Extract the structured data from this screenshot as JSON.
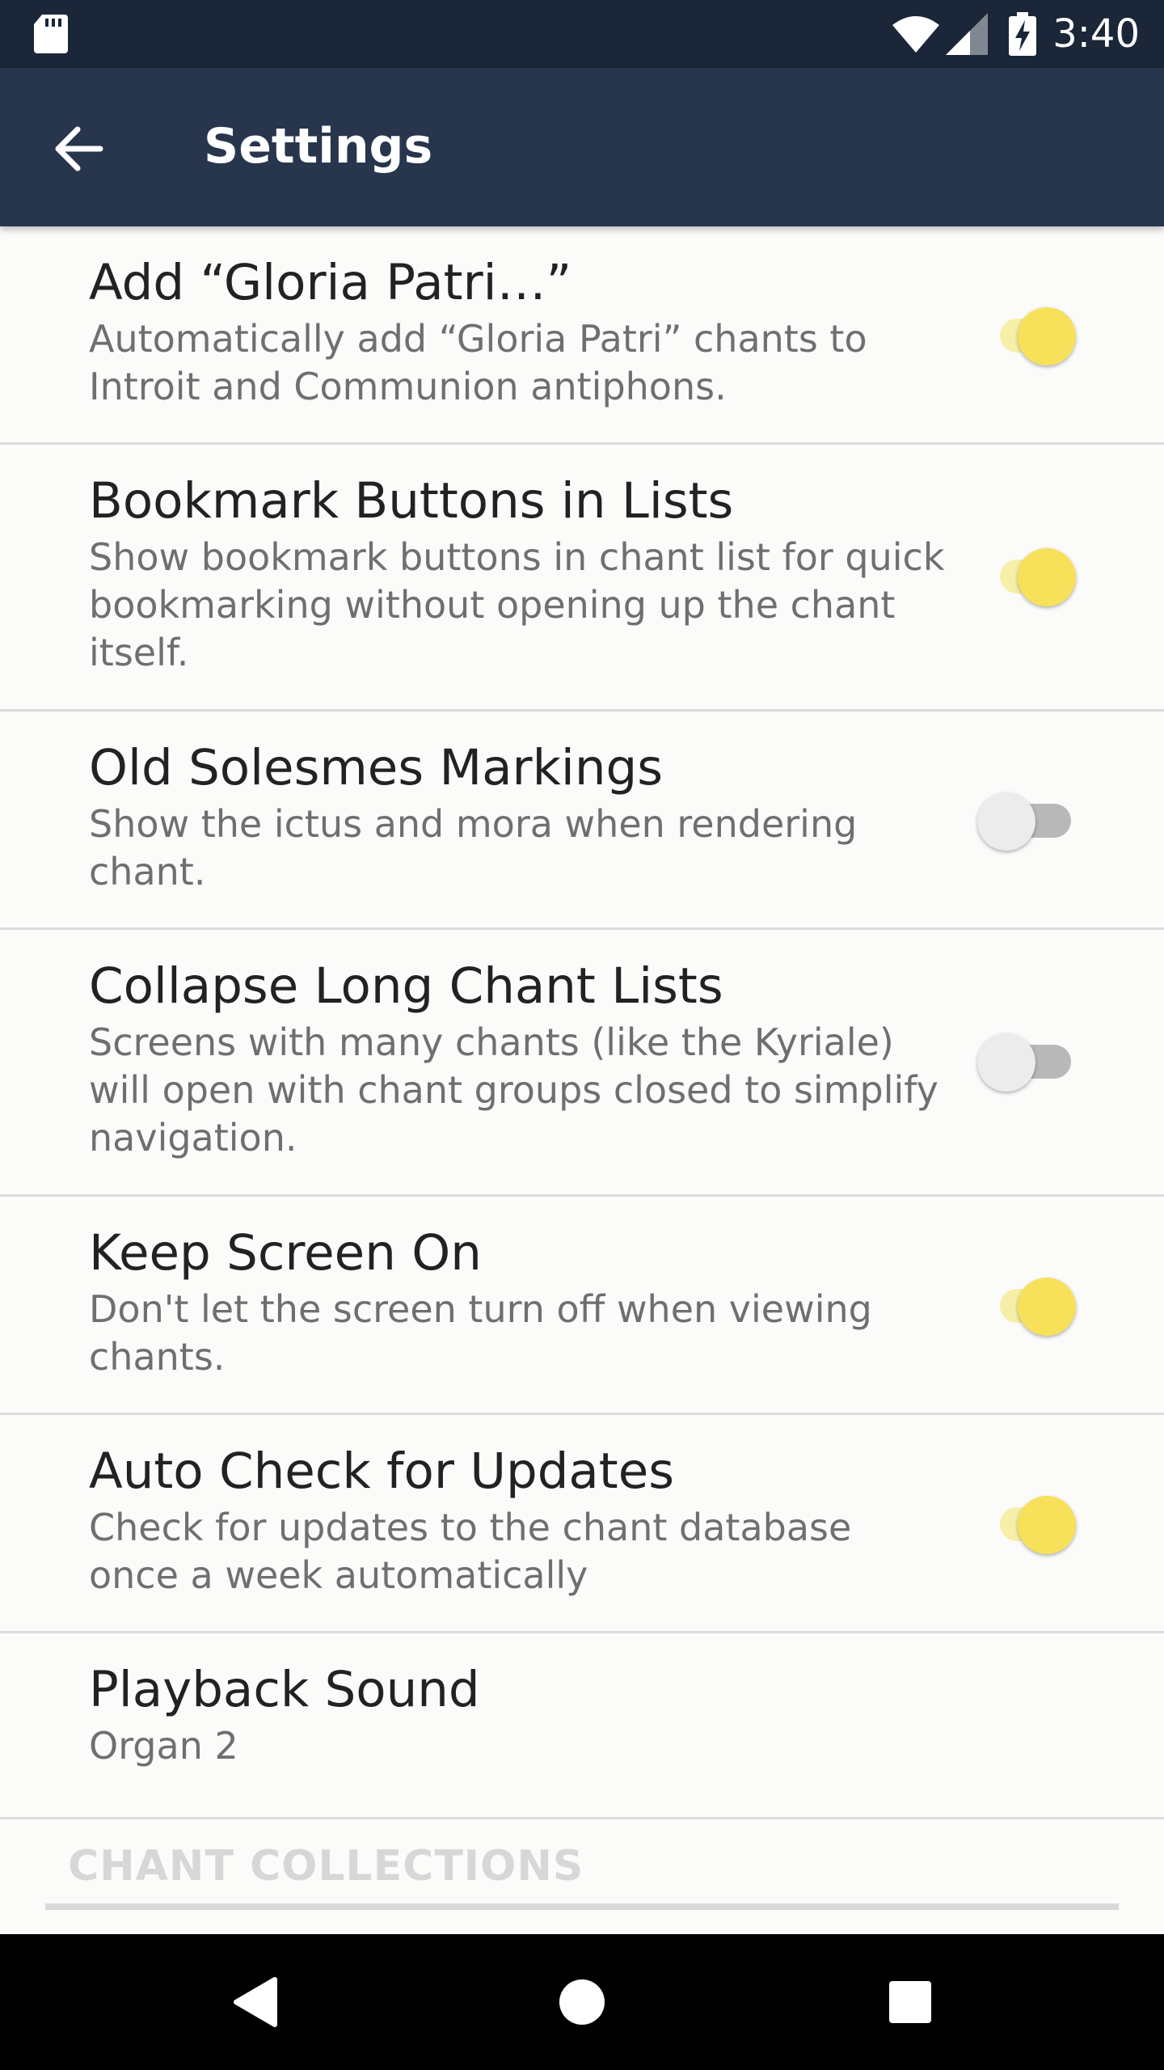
{
  "status_bar": {
    "time": "3:40",
    "icons": [
      "sd-card-icon",
      "wifi-icon",
      "signal-icon",
      "battery-charging-icon"
    ]
  },
  "app_bar": {
    "title": "Settings",
    "back_icon": "arrow-left-icon"
  },
  "settings": [
    {
      "title": "Add “Gloria Patri…”",
      "summary": "Automatically add “Gloria Patri” chants to Introit and Communion antiphons.",
      "switch_on": true
    },
    {
      "title": "Bookmark Buttons in Lists",
      "summary": "Show bookmark buttons in chant list for quick bookmarking without opening up the chant itself.",
      "switch_on": true
    },
    {
      "title": "Old Solesmes Markings",
      "summary": "Show the ictus and mora when rendering chant.",
      "switch_on": false
    },
    {
      "title": "Collapse Long Chant Lists",
      "summary": "Screens with many chants (like the Kyriale) will open with chant groups closed to simplify navigation.",
      "switch_on": false
    },
    {
      "title": "Keep Screen On",
      "summary": "Don't let the screen turn off when viewing chants.",
      "switch_on": true
    },
    {
      "title": "Auto Check for Updates",
      "summary": "Check for updates to the chant database once a week automatically",
      "switch_on": true
    },
    {
      "title": "Playback Sound",
      "summary": "Organ 2"
    }
  ],
  "section_header": "CHANT COLLECTIONS",
  "colors": {
    "status_bar": "#1b2638",
    "app_bar": "#27364d",
    "switch_on_thumb": "#f7e15a",
    "switch_on_track": "#f6efa8",
    "switch_off_thumb": "#ececec",
    "switch_off_track": "#b8b8b8"
  },
  "nav_bar": {
    "icons": [
      "back-triangle-icon",
      "home-circle-icon",
      "recents-square-icon"
    ]
  }
}
